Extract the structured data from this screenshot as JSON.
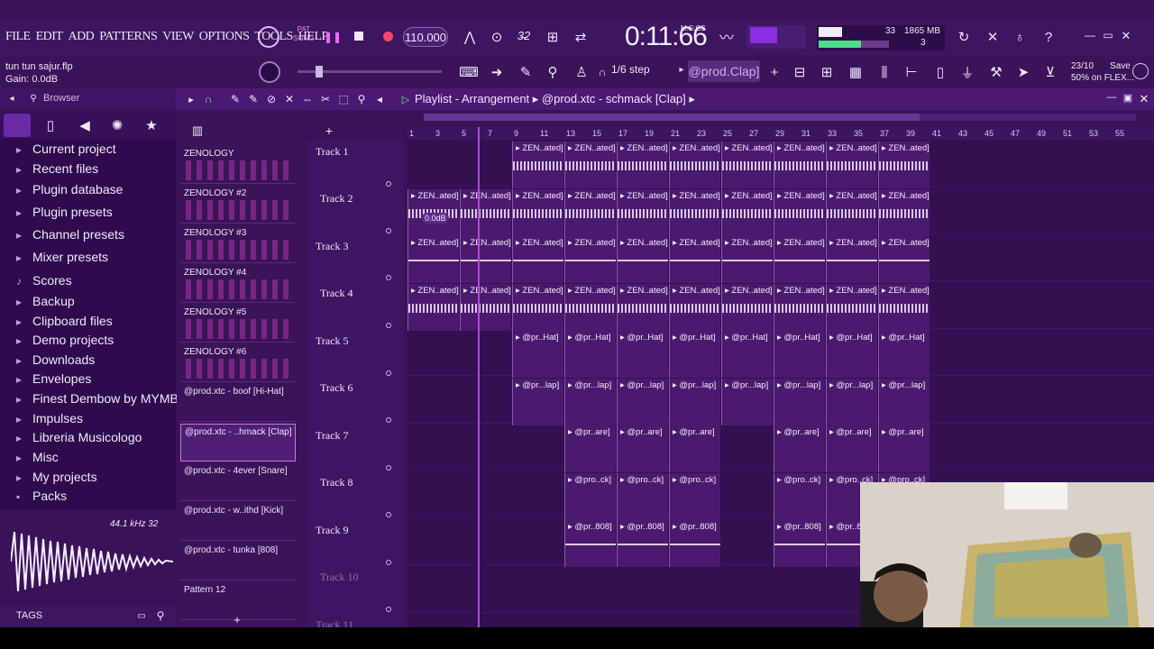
{
  "menu": [
    "FILE",
    "EDIT",
    "ADD",
    "PATTERNS",
    "VIEW",
    "OPTIONS",
    "TOOLS",
    "HELP"
  ],
  "hint": {
    "line1": "tun tun sajur.flp",
    "line2": "Gain:  0.0dB"
  },
  "transport": {
    "pat_label": "PAT",
    "song_label": "SONG",
    "tempo": "110.000"
  },
  "time": {
    "value": "0:11:66",
    "unit": "M:S:CS"
  },
  "cpu": {
    "cpu": "33",
    "memory": "1865 MB",
    "voices": "3"
  },
  "toolbar": {
    "step": "1/6 step",
    "pattern": "@prod.Clap]",
    "save_line1": "23/10",
    "save_word": "Save",
    "save_line2": "50% on FLEX..."
  },
  "browser": {
    "title": "Browser",
    "items": [
      "Current project",
      "Recent files",
      "Plugin database",
      "Plugin presets",
      "Channel presets",
      "Mixer presets",
      "Scores",
      "Backup",
      "Clipboard files",
      "Demo projects",
      "Downloads",
      "Envelopes",
      "Finest Dembow by MYMBA",
      "Impulses",
      "Libreria Musicologo",
      "Misc",
      "My projects",
      "Packs"
    ],
    "preview_info": "44.1 kHz 32",
    "tags": "TAGS"
  },
  "playlist": {
    "title": "Playlist - Arrangement",
    "crumb": "@prod.xtc - schmack [Clap]",
    "ruler": [
      "1",
      "3",
      "5",
      "7",
      "9",
      "11",
      "13",
      "15",
      "17",
      "19",
      "21",
      "23",
      "25",
      "27",
      "29",
      "31",
      "33",
      "35",
      "37",
      "39",
      "41",
      "43",
      "45",
      "47",
      "49",
      "51",
      "53",
      "55"
    ],
    "gain_bubble": "0.0dB",
    "patterns": [
      "ZENOLOGY",
      "ZENOLOGY #2",
      "ZENOLOGY #3",
      "ZENOLOGY #4",
      "ZENOLOGY #5",
      "ZENOLOGY #6",
      "@prod.xtc - boof [Hi-Hat]",
      "@prod.xtc - ..hmack [Clap]",
      "@prod.xtc - 4ever [Snare]",
      "@prod.xtc - w..ithd [Kick]",
      "@prod.xtc - tunka [808]",
      "Pattern 12"
    ],
    "tracks": [
      "Track 1",
      "Track 2",
      "Track 3",
      "Track 4",
      "Track 5",
      "Track 6",
      "Track 7",
      "Track 8",
      "Track 9",
      "Track 10",
      "Track 11"
    ],
    "clip_labels": {
      "zen": "ZEN..ated]",
      "hat": "@pr..Hat]",
      "clap": "@pr...lap]",
      "snare": "@pr..are]",
      "kick": "@pro..ck]",
      "bass": "@pr..808]"
    }
  },
  "colors": {
    "bg": "#3a1258",
    "accent": "#b04ad8",
    "clip": "#4b1a6e"
  }
}
